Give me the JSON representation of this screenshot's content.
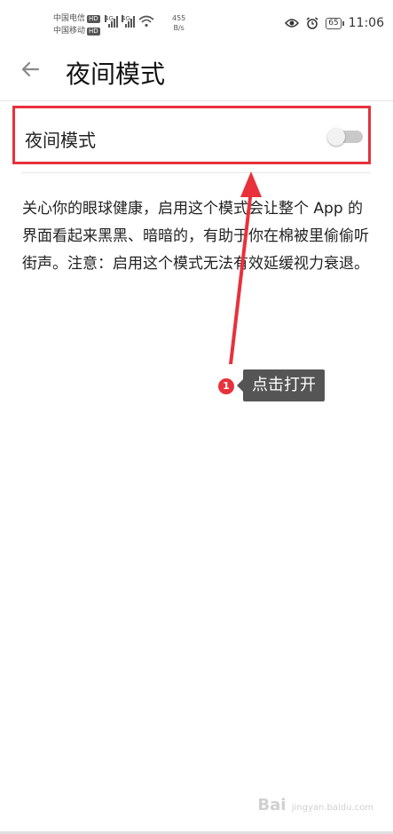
{
  "status_bar": {
    "carrier1": "中国电信",
    "carrier2": "中国移动",
    "hd_label": "HD",
    "network1": "4G",
    "network2": "4G",
    "speed_value": "455",
    "speed_unit": "B/s",
    "battery": "65",
    "time": "11:06",
    "icons": [
      "eye-icon",
      "alarm-icon",
      "wifi-icon",
      "signal-icon",
      "battery-icon"
    ]
  },
  "header": {
    "back_icon": "arrow-left-icon",
    "title": "夜间模式"
  },
  "setting": {
    "label": "夜间模式",
    "toggle_on": false
  },
  "description": "关心你的眼球健康，启用这个模式会让整个 App 的界面看起来黑黑、暗暗的，有助于你在棉被里偷偷听街声。注意：启用这个模式无法有效延缓视力衰退。",
  "annotation": {
    "step_number": "1",
    "tip": "点击打开",
    "color": "#e8313b"
  },
  "watermark": {
    "brand": "Bai",
    "sub": "jingyan.baidu.com"
  }
}
